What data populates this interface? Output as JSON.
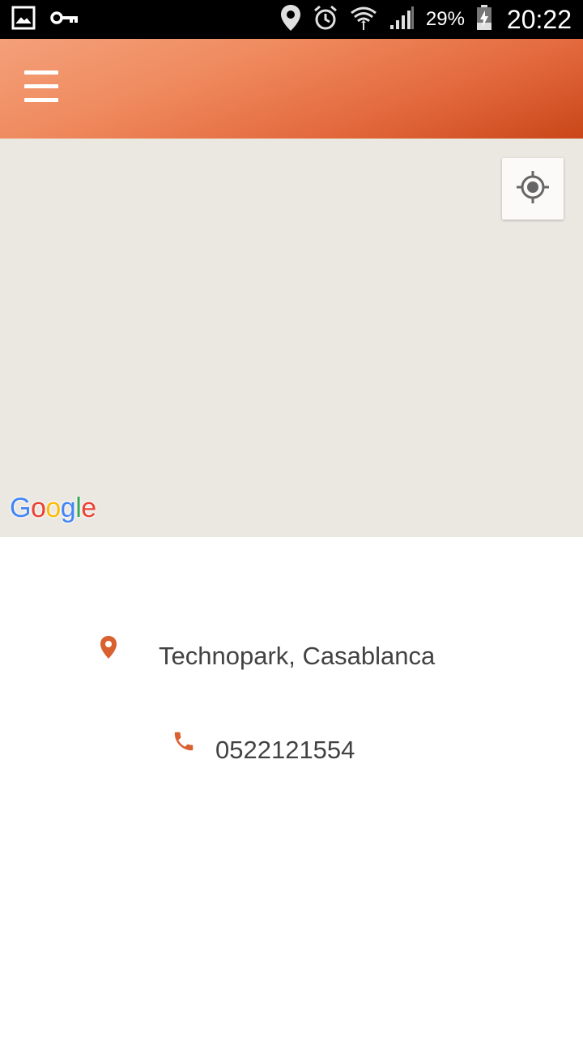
{
  "status_bar": {
    "left_icons": [
      "gallery-icon",
      "vpn-key-icon"
    ],
    "right_icons": [
      "location-icon",
      "alarm-icon",
      "wifi-icon",
      "cell-signal-icon",
      "battery-charging-icon"
    ],
    "battery_percent": "29%",
    "time": "20:22"
  },
  "app_bar": {
    "menu_icon": "hamburger-menu-icon",
    "gradient_colors": [
      "#f4a07a",
      "#ef8a5e",
      "#e2683c",
      "#c94618"
    ]
  },
  "map": {
    "background": "#ebe8e2",
    "locate_icon": "my-location-icon",
    "logo_letters": [
      {
        "char": "G",
        "color": "#4285f4"
      },
      {
        "char": "o",
        "color": "#ea4335"
      },
      {
        "char": "o",
        "color": "#fbbc05"
      },
      {
        "char": "g",
        "color": "#4285f4"
      },
      {
        "char": "l",
        "color": "#34a853"
      },
      {
        "char": "e",
        "color": "#ea4335"
      }
    ]
  },
  "contact": {
    "accent_color": "#d9602f",
    "address": "Technopark, Casablanca",
    "address_icon": "location-pin-icon",
    "phone": "0522121554",
    "phone_icon": "phone-icon"
  }
}
